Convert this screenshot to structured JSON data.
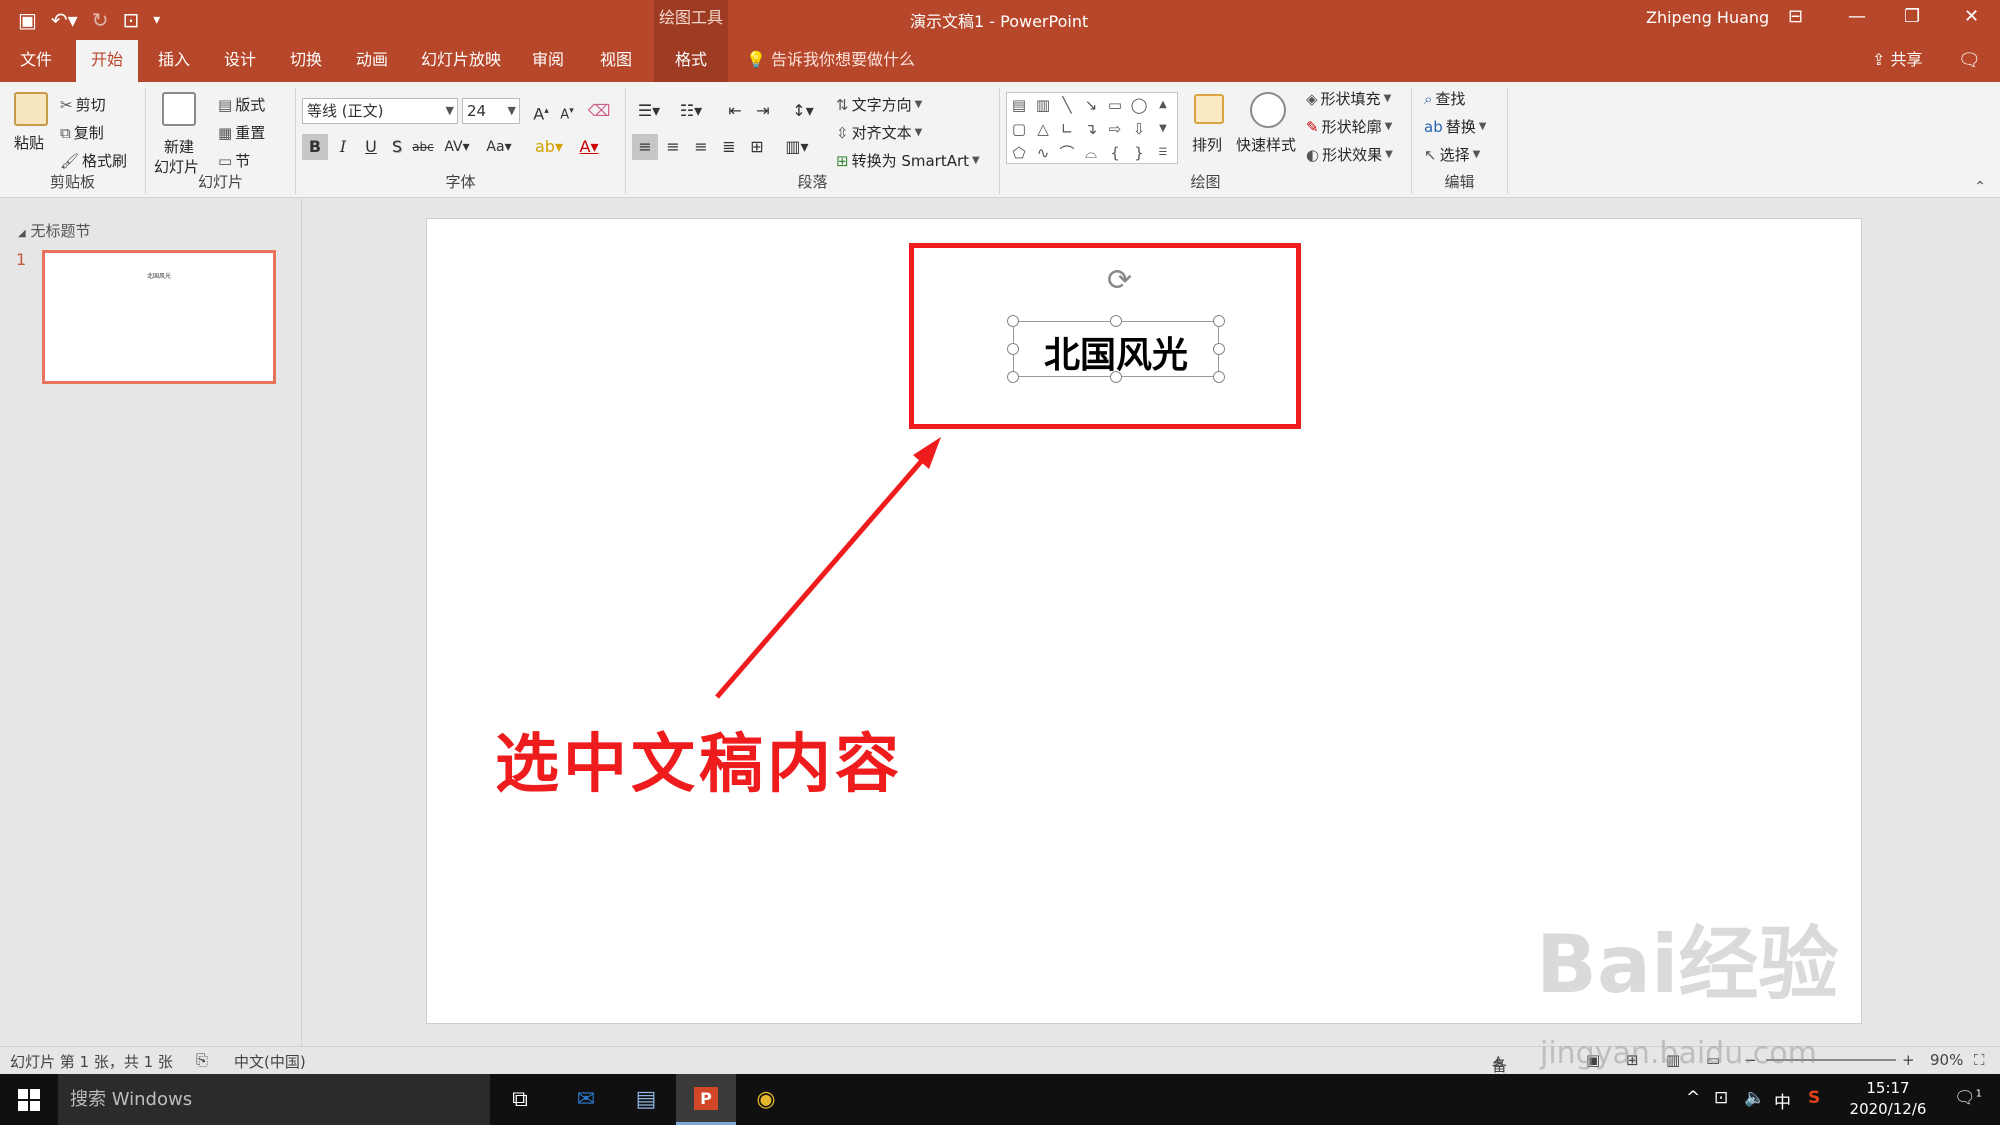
{
  "titlebar": {
    "drawing_tools": "绘图工具",
    "title": "演示文稿1  -  PowerPoint",
    "user": "Zhipeng Huang"
  },
  "tabs": [
    "文件",
    "开始",
    "插入",
    "设计",
    "切换",
    "动画",
    "幻灯片放映",
    "审阅",
    "视图",
    "格式"
  ],
  "active_tab": "开始",
  "tell_me": "告诉我你想要做什么",
  "share": "共享",
  "ribbon": {
    "clipboard": {
      "label": "剪贴板",
      "paste": "粘贴",
      "cut": "剪切",
      "copy": "复制",
      "format_painter": "格式刷"
    },
    "slides": {
      "label": "幻灯片",
      "new_slide_1": "新建",
      "new_slide_2": "幻灯片",
      "layout": "版式",
      "reset": "重置",
      "section": "节"
    },
    "font": {
      "label": "字体",
      "font_name": "等线 (正文)",
      "font_size": "24"
    },
    "paragraph": {
      "label": "段落",
      "text_direction": "文字方向",
      "align_text": "对齐文本",
      "smartart": "转换为 SmartArt"
    },
    "drawing": {
      "label": "绘图",
      "arrange": "排列",
      "quick_styles": "快速样式",
      "shape_fill": "形状填充",
      "shape_outline": "形状轮廓",
      "shape_effects": "形状效果"
    },
    "editing": {
      "label": "编辑",
      "find": "查找",
      "replace": "替换",
      "select": "选择"
    }
  },
  "thumbs": {
    "section": "无标题节",
    "slide_number": "1",
    "thumb_text": "北国风光"
  },
  "slide": {
    "text": "北国风光",
    "annotation": "选中文稿内容"
  },
  "status": {
    "slide_info": "幻灯片 第 1 张，共 1 张",
    "language": "中文(中国)",
    "notes": "备注",
    "zoom": "90%"
  },
  "taskbar": {
    "search": "搜索 Windows",
    "ime": "中",
    "time": "15:17",
    "date": "2020/12/6",
    "notif_count": "1"
  },
  "watermark": {
    "brand": "Bai经验",
    "url": "jingyan.baidu.com"
  }
}
